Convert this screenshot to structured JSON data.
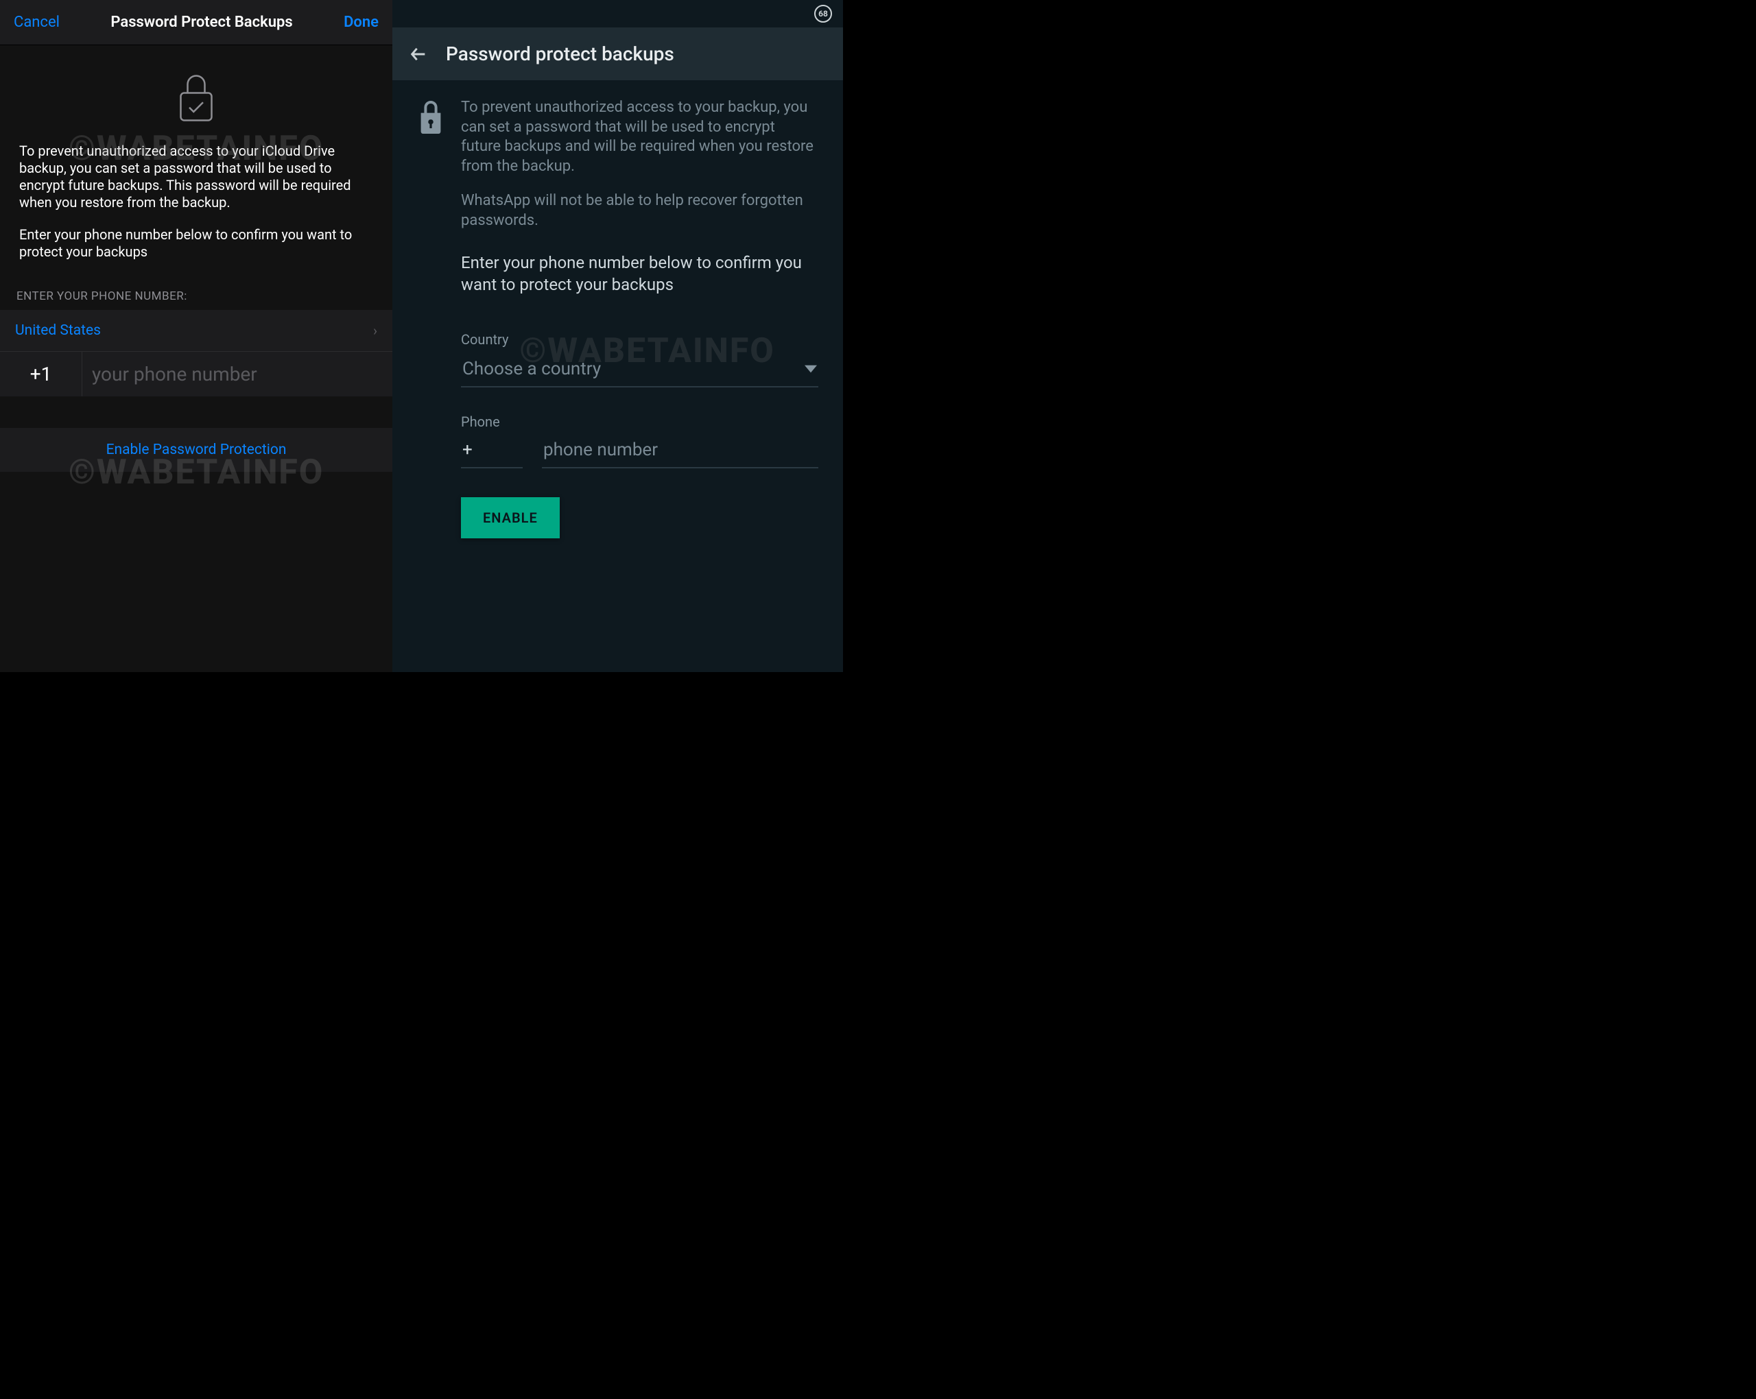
{
  "watermark": "©WABETAINFO",
  "ios": {
    "cancel": "Cancel",
    "title": "Password Protect Backups",
    "done": "Done",
    "desc1": "To prevent unauthorized access to your iCloud Drive backup, you can set a password that will be used to encrypt future backups. This password will be required when you restore from the backup.",
    "desc2": "Enter your phone number below to confirm you want to protect your backups",
    "sectionTitle": "ENTER YOUR PHONE NUMBER:",
    "country": "United States",
    "prefix": "+1",
    "phonePlaceholder": "your phone number",
    "enable": "Enable Password Protection"
  },
  "android": {
    "statusBadge": "68",
    "title": "Password protect backups",
    "desc1": "To prevent unauthorized access to your backup, you can set a password that will be used to encrypt future backups and will be required when you restore from the backup.",
    "desc2": "WhatsApp will not be able to help recover forgotten passwords.",
    "confirm": "Enter your phone number below to confirm you want to protect your backups",
    "countryLabel": "Country",
    "countryPlaceholder": "Choose a country",
    "phoneLabel": "Phone",
    "plus": "+",
    "phonePlaceholder": "phone number",
    "enable": "ENABLE"
  }
}
